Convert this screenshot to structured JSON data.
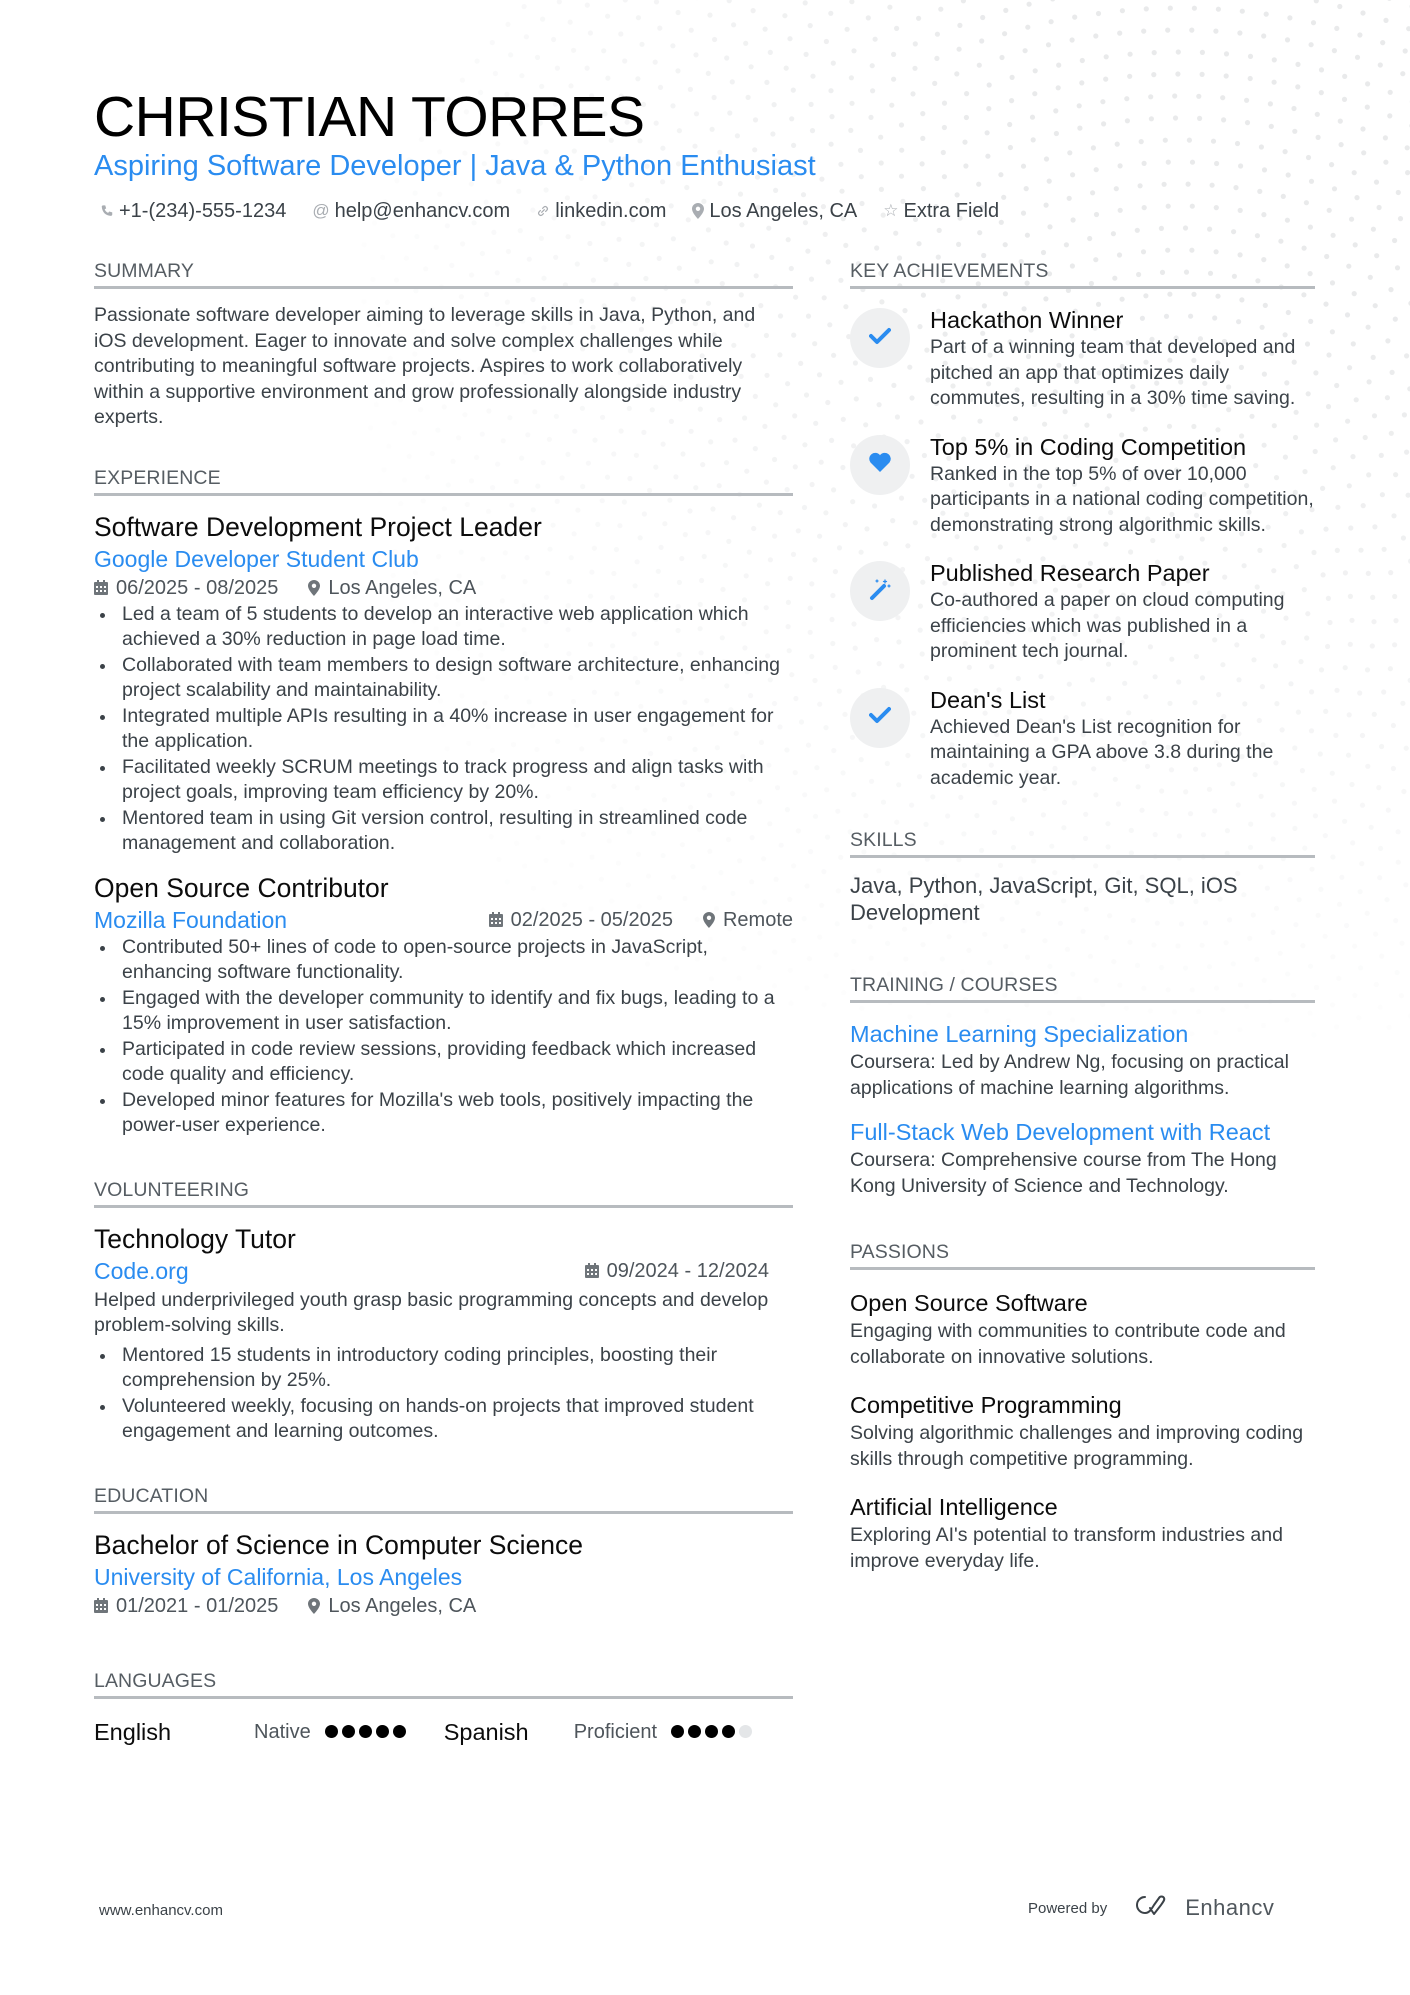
{
  "header": {
    "name": "CHRISTIAN TORRES",
    "title": "Aspiring Software Developer | Java & Python Enthusiast",
    "contacts": [
      {
        "icon": "phone-icon",
        "text": "+1-(234)-555-1234"
      },
      {
        "icon": "at-icon",
        "text": "help@enhancv.com"
      },
      {
        "icon": "link-icon",
        "text": "linkedin.com"
      },
      {
        "icon": "location-icon",
        "text": "Los Angeles, CA"
      },
      {
        "icon": "star-icon",
        "text": "Extra Field"
      }
    ]
  },
  "summary": {
    "heading": "SUMMARY",
    "text": "Passionate software developer aiming to leverage skills in Java, Python, and iOS development. Eager to innovate and solve complex challenges while contributing to meaningful software projects. Aspires to work collaboratively within a supportive environment and grow professionally alongside industry experts."
  },
  "experience": {
    "heading": "EXPERIENCE",
    "items": [
      {
        "title": "Software Development Project Leader",
        "org": "Google Developer Student Club",
        "dates": "06/2025 - 08/2025",
        "location": "Los Angeles, CA",
        "bullets": [
          "Led a team of 5 students to develop an interactive web application which achieved a 30% reduction in page load time.",
          "Collaborated with team members to design software architecture, enhancing project scalability and maintainability.",
          "Integrated multiple APIs resulting in a 40% increase in user engagement for the application.",
          "Facilitated weekly SCRUM meetings to track progress and align tasks with project goals, improving team efficiency by 20%.",
          "Mentored team in using Git version control, resulting in streamlined code management and collaboration."
        ]
      },
      {
        "title": "Open Source Contributor",
        "org": "Mozilla Foundation",
        "dates": "02/2025 - 05/2025",
        "location": "Remote",
        "bullets": [
          "Contributed 50+ lines of code to open-source projects in JavaScript, enhancing software functionality.",
          "Engaged with the developer community to identify and fix bugs, leading to a 15% improvement in user satisfaction.",
          "Participated in code review sessions, providing feedback which increased code quality and efficiency.",
          "Developed minor features for Mozilla's web tools, positively impacting the power-user experience."
        ]
      }
    ]
  },
  "volunteering": {
    "heading": "VOLUNTEERING",
    "items": [
      {
        "title": "Technology Tutor",
        "org": "Code.org",
        "dates": "09/2024 - 12/2024",
        "description": "Helped underprivileged youth grasp basic programming concepts and develop problem-solving skills.",
        "bullets": [
          "Mentored 15 students in introductory coding principles, boosting their comprehension by 25%.",
          "Volunteered weekly, focusing on hands-on projects that improved student engagement and learning outcomes."
        ]
      }
    ]
  },
  "education": {
    "heading": "EDUCATION",
    "items": [
      {
        "degree": "Bachelor of Science in Computer Science",
        "school": "University of California, Los Angeles",
        "dates": "01/2021 - 01/2025",
        "location": "Los Angeles, CA"
      }
    ]
  },
  "languages": {
    "heading": "LANGUAGES",
    "items": [
      {
        "name": "English",
        "level": "Native",
        "rating": 5,
        "max": 5
      },
      {
        "name": "Spanish",
        "level": "Proficient",
        "rating": 4,
        "max": 5
      }
    ]
  },
  "achievements": {
    "heading": "KEY ACHIEVEMENTS",
    "items": [
      {
        "icon": "check-icon",
        "title": "Hackathon Winner",
        "description": "Part of a winning team that developed and pitched an app that optimizes daily commutes, resulting in a 30% time saving."
      },
      {
        "icon": "heart-icon",
        "title": "Top 5% in Coding Competition",
        "description": "Ranked in the top 5% of over 10,000 participants in a national coding competition, demonstrating strong algorithmic skills."
      },
      {
        "icon": "magic-wand-icon",
        "title": "Published Research Paper",
        "description": "Co-authored a paper on cloud computing efficiencies which was published in a prominent tech journal."
      },
      {
        "icon": "check-icon",
        "title": "Dean's List",
        "description": "Achieved Dean's List recognition for maintaining a GPA above 3.8 during the academic year."
      }
    ]
  },
  "skills": {
    "heading": "SKILLS",
    "text": "Java, Python, JavaScript, Git, SQL, iOS Development"
  },
  "training": {
    "heading": "TRAINING / COURSES",
    "items": [
      {
        "title": "Machine Learning Specialization",
        "description": "Coursera: Led by Andrew Ng, focusing on practical applications of machine learning algorithms."
      },
      {
        "title": "Full-Stack Web Development with React",
        "description": "Coursera: Comprehensive course from The Hong Kong University of Science and Technology."
      }
    ]
  },
  "passions": {
    "heading": "PASSIONS",
    "items": [
      {
        "title": "Open Source Software",
        "description": "Engaging with communities to contribute code and collaborate on innovative solutions."
      },
      {
        "title": "Competitive Programming",
        "description": "Solving algorithmic challenges and improving coding skills through competitive programming."
      },
      {
        "title": "Artificial Intelligence",
        "description": "Exploring AI's potential to transform industries and improve everyday life."
      }
    ]
  },
  "footer": {
    "website": "www.enhancv.com",
    "powered_by": "Powered by",
    "brand": "Enhancv"
  },
  "colors": {
    "accent": "#2a8cf0",
    "heading_rule": "#b7bbbf",
    "text": "#3b4248"
  }
}
